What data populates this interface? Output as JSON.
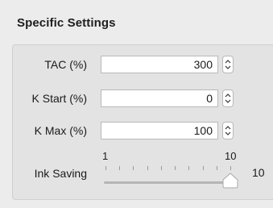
{
  "section": {
    "title": "Specific Settings"
  },
  "fields": [
    {
      "label": "TAC (%)",
      "value": "300"
    },
    {
      "label": "K Start (%)",
      "value": "0"
    },
    {
      "label": "K Max (%)",
      "value": "100"
    }
  ],
  "ink_saving": {
    "label": "Ink Saving",
    "min_label": "1",
    "max_label": "10",
    "value": "10",
    "min": 1,
    "max": 10,
    "current": 10
  },
  "colors": {
    "panel_bg": "#ececec",
    "group_bg": "#e3e3e3",
    "field_border": "#b9b9b9"
  }
}
